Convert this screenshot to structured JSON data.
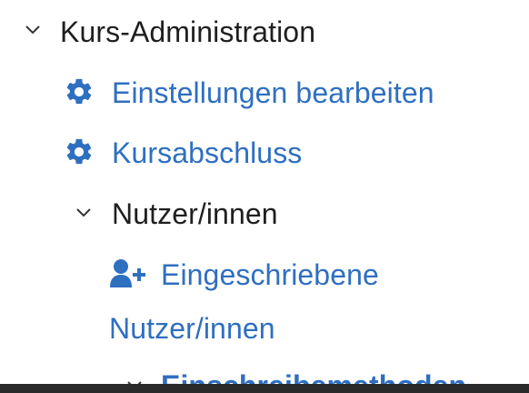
{
  "nav": {
    "course_admin": {
      "label": "Kurs-Administration"
    },
    "items": [
      {
        "label": "Einstellungen bearbeiten",
        "icon": "gear-icon"
      },
      {
        "label": "Kursabschluss",
        "icon": "gear-icon"
      }
    ],
    "users": {
      "label": "Nutzer/innen",
      "enrolled_line1": "Eingeschriebene",
      "enrolled_line2": "Nutzer/innen",
      "enrolled_icon": "user-plus-icon",
      "enrolment_methods": "Einschreibemethoden"
    }
  },
  "colors": {
    "link": "#2f6fc0",
    "text": "#1f1f1f",
    "chevron": "#333333"
  }
}
